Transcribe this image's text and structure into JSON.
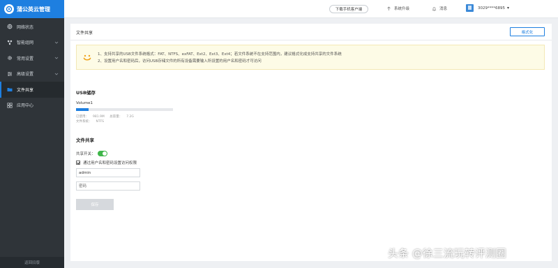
{
  "brand": {
    "title": "蒲公英云管理"
  },
  "sidebar": {
    "items": [
      {
        "label": "网络状态",
        "icon": "network-icon",
        "has_submenu": false,
        "active": false
      },
      {
        "label": "智能组网",
        "icon": "mesh-icon",
        "has_submenu": true,
        "active": false
      },
      {
        "label": "常用设置",
        "icon": "gear-icon",
        "has_submenu": true,
        "active": false
      },
      {
        "label": "高级设置",
        "icon": "sliders-icon",
        "has_submenu": true,
        "active": false
      },
      {
        "label": "文件共享",
        "icon": "folder-icon",
        "has_submenu": false,
        "active": true
      },
      {
        "label": "应用中心",
        "icon": "grid-icon",
        "has_submenu": false,
        "active": false
      }
    ],
    "footer": "返回旧版"
  },
  "topbar": {
    "download_app": "下载手机客户端",
    "upgrade": "系统升级",
    "messages": "消息",
    "account": "3029****6895"
  },
  "panel": {
    "title": "文件共享",
    "format_button": "格式化"
  },
  "notice": {
    "lines": [
      "1、支持共享的USB文件系统格式：FAT、NTFS、exFAT、Ext2、Ext3、Ext4；若文件系统不在支持范围内，建议格式化成支持共享的文件系统",
      "2、设置用户名和密码后，访问USB存储文件的所有设备需要输入所设置的用户名和密码才可访问"
    ]
  },
  "usb": {
    "section_title": "USB储存",
    "volume_name": "Volume1",
    "used_label": "已使用：",
    "used_value": "981.9M",
    "capacity_label": "总容量：",
    "capacity_value": "7.2G",
    "filesystem_label": "文件系统：",
    "filesystem_value": "NTFS",
    "usage_fraction": 0.13
  },
  "share": {
    "section_title": "文件共享",
    "switch_label": "共享开关：",
    "switch_on": true,
    "auth_checkbox_label": "通过用户名和密码设置访问权限",
    "auth_checked": true,
    "username_value": "admin",
    "password_placeholder": "密码",
    "save_button": "保存"
  },
  "watermark": "头条 @徐三流玩转评测圈",
  "colors": {
    "brand_blue": "#1e7fe0",
    "sidebar_bg": "#2f3439",
    "toggle_green": "#3fb64a",
    "notice_bg": "#fdfbe6"
  }
}
